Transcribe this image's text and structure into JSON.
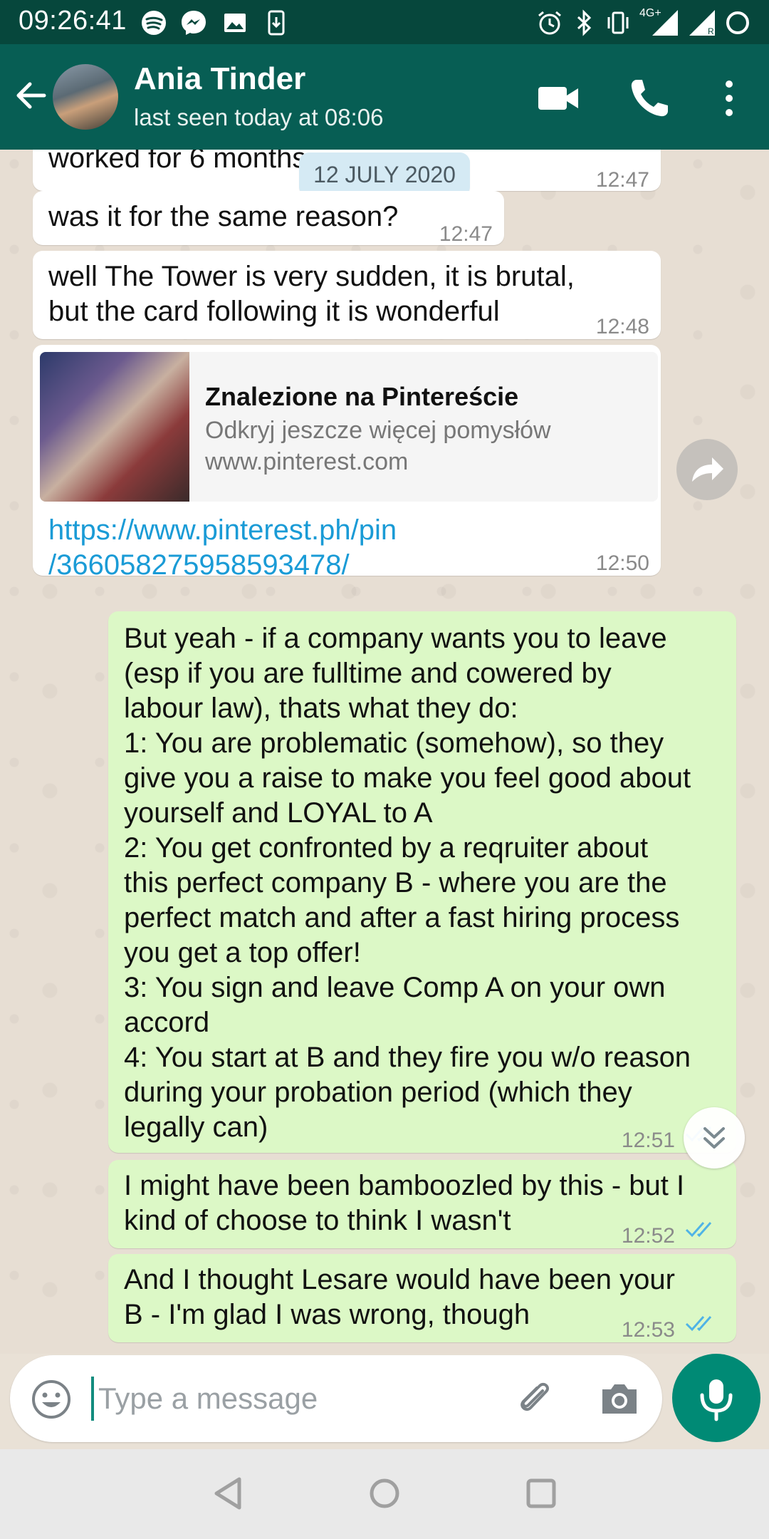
{
  "status_bar": {
    "time": "09:26:41",
    "network": "4G+"
  },
  "app_bar": {
    "name": "Ania Tinder",
    "status": "last seen today at 08:06"
  },
  "date_chip": "12 JULY 2020",
  "messages": [
    {
      "dir": "in",
      "text": "worked for 6 months",
      "time": "12:47"
    },
    {
      "dir": "in",
      "text": "was it for the same reason?",
      "time": "12:47"
    },
    {
      "dir": "in",
      "lines": [
        "well The Tower is very sudden, it is brutal,",
        "but the card following it is wonderful"
      ],
      "time": "12:48"
    },
    {
      "dir": "in",
      "type": "link",
      "preview_title": "Znalezione na Pintereście",
      "preview_desc": "Odkryj jeszcze więcej pomysłów",
      "preview_domain": "www.pinterest.com",
      "url_lines": [
        "https://www.pinterest.ph/pin",
        "/366058275958593478/"
      ],
      "time": "12:50"
    },
    {
      "dir": "out",
      "status": "read",
      "time": "12:51",
      "lines": [
        "But yeah - if a company wants you to leave",
        "(esp if you are fulltime and cowered by",
        "labour law), thats what they do:",
        "1: You are problematic (somehow), so they",
        "give you a raise to make you feel good about",
        "yourself and LOYAL to A",
        "2: You get confronted by a reqruiter about",
        "this perfect company B - where you are the",
        "perfect match and after a fast hiring process",
        "you get a top offer!",
        "3: You sign and leave Comp A on your own",
        "accord",
        "4: You start at B and they fire you w/o reason",
        "during your probation period (which they",
        "legally can)"
      ]
    },
    {
      "dir": "out",
      "status": "read",
      "time": "12:52",
      "lines": [
        "I might have been bamboozled by this - but I",
        "kind of choose to think I wasn't"
      ]
    },
    {
      "dir": "out",
      "status": "read",
      "time": "12:53",
      "lines": [
        "And I thought Lesare would have been your",
        "B - I'm glad I was wrong, though"
      ]
    }
  ],
  "input": {
    "placeholder": "Type a message"
  },
  "colors": {
    "header": "#075e54",
    "outgoing": "#dcf8c6",
    "link": "#1a9bd6",
    "read_ticks": "#4fb3e6",
    "fab": "#008a75"
  },
  "icons": [
    "back-arrow-icon",
    "video-call-icon",
    "phone-icon",
    "more-vert-icon",
    "forward-icon",
    "double-chevron-down-icon",
    "emoji-icon",
    "paperclip-icon",
    "camera-icon",
    "mic-icon",
    "nav-back-icon",
    "nav-home-icon",
    "nav-recents-icon"
  ]
}
